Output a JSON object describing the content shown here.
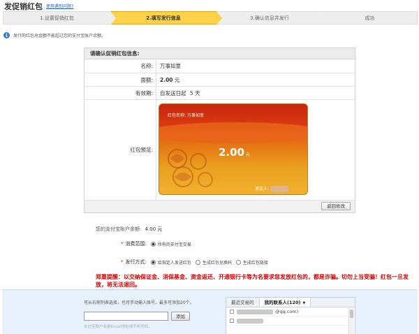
{
  "header": {
    "title": "发促销红包",
    "help_link": "使用遇到问题?"
  },
  "steps": [
    {
      "label": "1.设置促销红包",
      "active": false
    },
    {
      "label": "2.填写发行信息",
      "active": true
    },
    {
      "label": "3.确认信息并发行",
      "active": false
    },
    {
      "label": "成功",
      "active": false
    }
  ],
  "notice": "发行的红包总金额不能超过您的支付宝账户余额。",
  "confirm": {
    "header": "请确认促销红包信息:",
    "name_label": "名称:",
    "name_value": "万事如意",
    "amount_label": "面额:",
    "amount_value": "2.00",
    "amount_unit": "元",
    "validity_label": "有效期:",
    "validity_value": "自发送日起",
    "validity_days": "5 天",
    "preview_label": "红包预览:",
    "back_button": "返回修改"
  },
  "card": {
    "name_prefix": "红包名称:",
    "name": "万事如意",
    "amount": "2.00",
    "unit": "元",
    "sender_label": "发送人:"
  },
  "balance": {
    "label": "您的支付宝账户余额:",
    "value": "4.00 元"
  },
  "scope": {
    "label": "消费范围:",
    "option": "所有的支付宝交易"
  },
  "issue": {
    "label": "发行方式:",
    "options": [
      "给指定人发送红包",
      "生成红包兑换码",
      "生成红包链接"
    ],
    "selected": 0
  },
  "warning": "郑重提醒：以交纳保证金、消保基金、资金返还、开通银行卡等为名要求您发放红包的，都是诈骗。切勿上当受骗！红包一旦发放，将无法退回。",
  "recipients": {
    "hint": "可从右侧列表选择，也可手动输入账号，最多可添加20个。",
    "input_placeholder": "",
    "add_button": "添加",
    "sub_hint": "支付宝账户名是Email地址或手机号码。",
    "tabs": [
      "最近交易的",
      "我的联系人(120)"
    ],
    "active_tab": 1,
    "contacts": [
      "@qq.com)",
      ""
    ]
  },
  "colors": {
    "active_step": "#ffd24a",
    "warning": "#e20000",
    "card_top": "#c9260e",
    "card_bottom": "#f0b12e",
    "link": "#1a66c0"
  }
}
